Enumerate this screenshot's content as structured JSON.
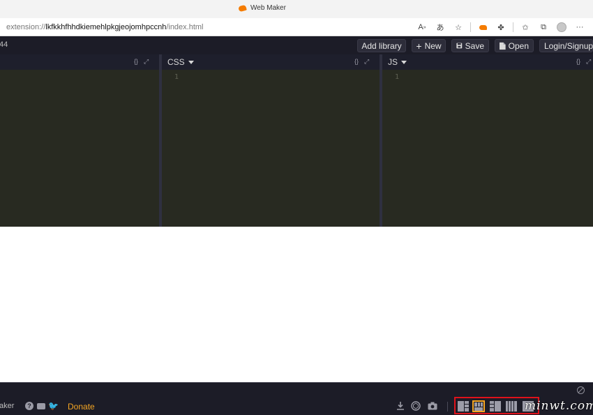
{
  "browser": {
    "tab_title": "Web Maker",
    "url_prefix": "extension://",
    "url_host": "lkfkkhfhhdkiemehlpkgjeojomhpccnh",
    "url_path": "/index.html",
    "icons": [
      "read-aloud-icon",
      "translate-icon",
      "favorite-icon",
      "webmaker-extension-icon",
      "extensions-icon",
      "favorites-icon",
      "collections-icon",
      "profile-icon",
      "more-icon"
    ]
  },
  "header": {
    "count": "44",
    "add_library": "Add library",
    "new_label": "New",
    "save_label": "Save",
    "open_label": "Open",
    "login_label": "Login/Signup"
  },
  "editors": {
    "html": {
      "title": "",
      "line": ""
    },
    "css": {
      "title": "CSS",
      "line": "1"
    },
    "js": {
      "title": "JS",
      "line": "1"
    }
  },
  "footer": {
    "brand": "aker",
    "donate": "Donate",
    "watermark": "minwt.com"
  },
  "colors": {
    "accent": "#f5a623",
    "highlight_box": "#e0121b",
    "editor_bg": "#282a21",
    "chrome_dark": "#1c1c27"
  }
}
